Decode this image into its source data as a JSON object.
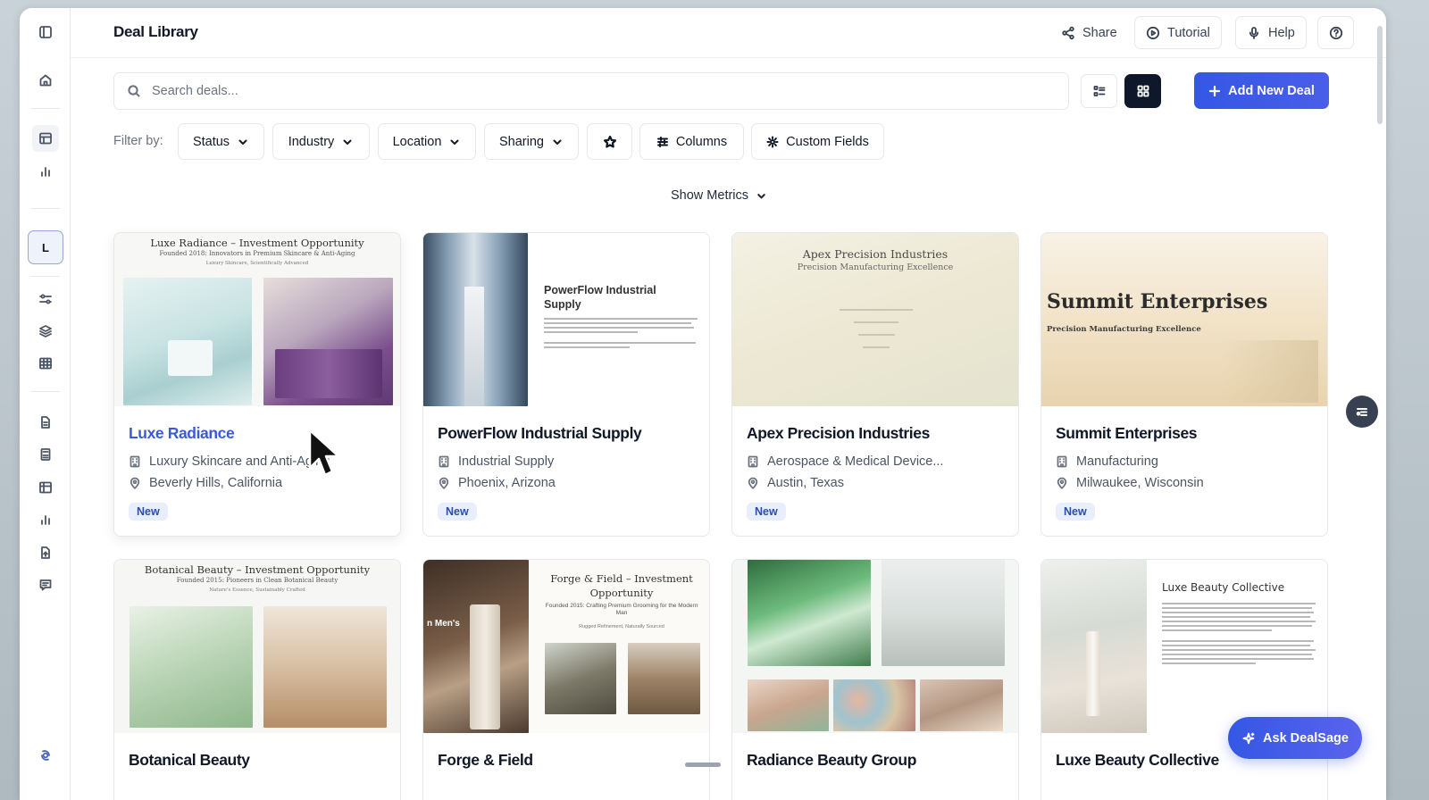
{
  "app": {
    "title": "Deal Library",
    "avatar_letter": "L"
  },
  "header": {
    "share": "Share",
    "tutorial": "Tutorial",
    "help": "Help"
  },
  "search": {
    "placeholder": "Search deals..."
  },
  "toolbar": {
    "add_new_deal": "Add New Deal"
  },
  "filters": {
    "label": "Filter by:",
    "status": "Status",
    "industry": "Industry",
    "location": "Location",
    "sharing": "Sharing",
    "columns": "Columns",
    "custom_fields": "Custom Fields"
  },
  "metrics": {
    "label": "Show Metrics"
  },
  "deals": [
    {
      "name": "Luxe Radiance",
      "industry": "Luxury Skincare and Anti-Aging",
      "location": "Beverly Hills, California",
      "status": "New",
      "thumb_title": "Luxe Radiance – Investment Opportunity",
      "thumb_sub": "Founded 2018: Innovators in Premium Skincare & Anti-Aging",
      "thumb_tag": "Luxury Skincare, Scientifically Advanced"
    },
    {
      "name": "PowerFlow Industrial Supply",
      "industry": "Industrial Supply",
      "location": "Phoenix, Arizona",
      "status": "New",
      "thumb_title": "PowerFlow Industrial Supply"
    },
    {
      "name": "Apex Precision Industries",
      "industry": "Aerospace & Medical Device...",
      "location": "Austin, Texas",
      "status": "New",
      "thumb_title": "Apex Precision Industries",
      "thumb_sub": "Precision Manufacturing Excellence"
    },
    {
      "name": "Summit Enterprises",
      "industry": "Manufacturing",
      "location": "Milwaukee, Wisconsin",
      "status": "New",
      "thumb_title": "Summit Enterprises",
      "thumb_sub": "Precision Manufacturing Excellence"
    },
    {
      "name": "Botanical Beauty",
      "thumb_title": "Botanical Beauty – Investment Opportunity",
      "thumb_sub": "Founded 2015: Pioneers in Clean Botanical Beauty",
      "thumb_tag": "Nature's Essence, Sustainably Crafted"
    },
    {
      "name": "Forge & Field",
      "thumb_title": "Forge & Field – Investment Opportunity",
      "thumb_sub": "Founded 2015: Crafting Premium Grooming for the Modern Man",
      "thumb_tag": "Rugged Refinement, Naturally Sourced",
      "thumb_side": "n Men's"
    },
    {
      "name": "Radiance Beauty Group"
    },
    {
      "name": "Luxe Beauty Collective",
      "thumb_title": "Luxe Beauty Collective"
    }
  ],
  "assistant": {
    "label": "Ask DealSage"
  },
  "colors": {
    "accent": "#3457e6",
    "link": "#3a5ad9",
    "badge_bg": "#e8eefb",
    "dark_toggle": "#0f172a"
  }
}
